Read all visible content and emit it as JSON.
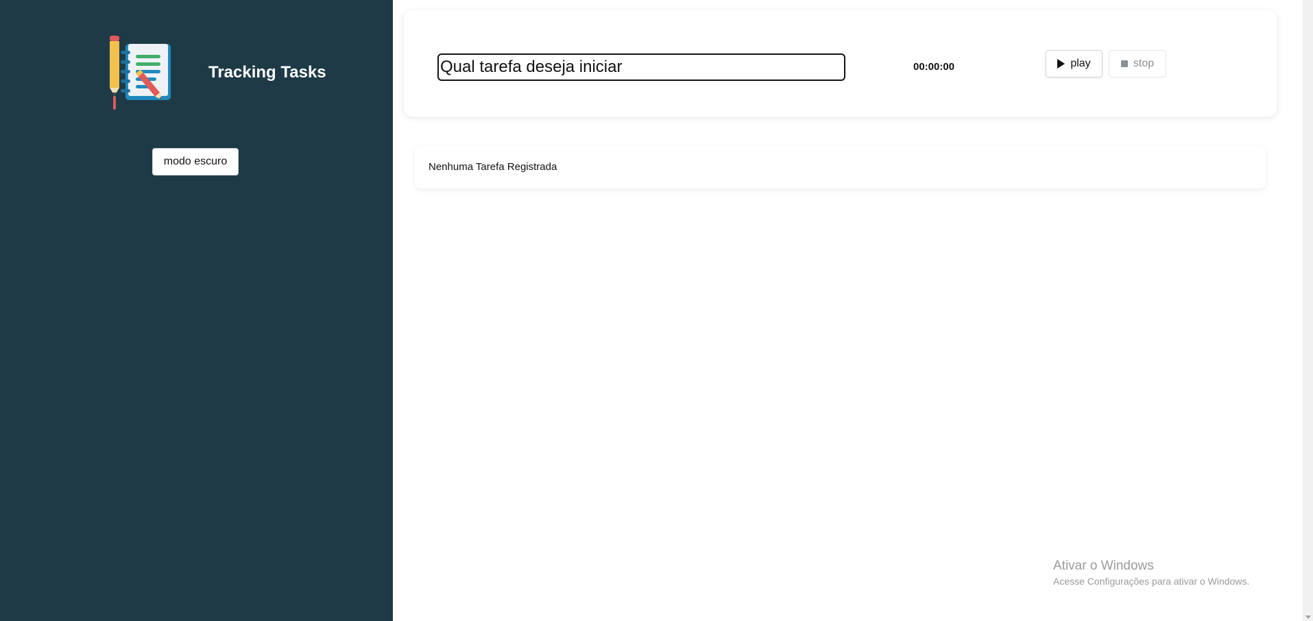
{
  "sidebar": {
    "title": "Tracking Tasks",
    "theme_toggle_label": "modo escuro",
    "logo_icon": "notebook-pencil-icon",
    "background_color": "#1e3a46"
  },
  "timer": {
    "task_placeholder": "Qual tarefa deseja iniciar",
    "task_value": "",
    "time": "00:00:00",
    "play_label": "play",
    "play_icon": "play-icon",
    "stop_label": "stop",
    "stop_icon": "stop-icon"
  },
  "task_list": {
    "empty_message": "Nenhuma Tarefa Registrada"
  },
  "os_watermark": {
    "title": "Ativar o Windows",
    "subtitle": "Acesse Configurações para ativar o Windows."
  }
}
